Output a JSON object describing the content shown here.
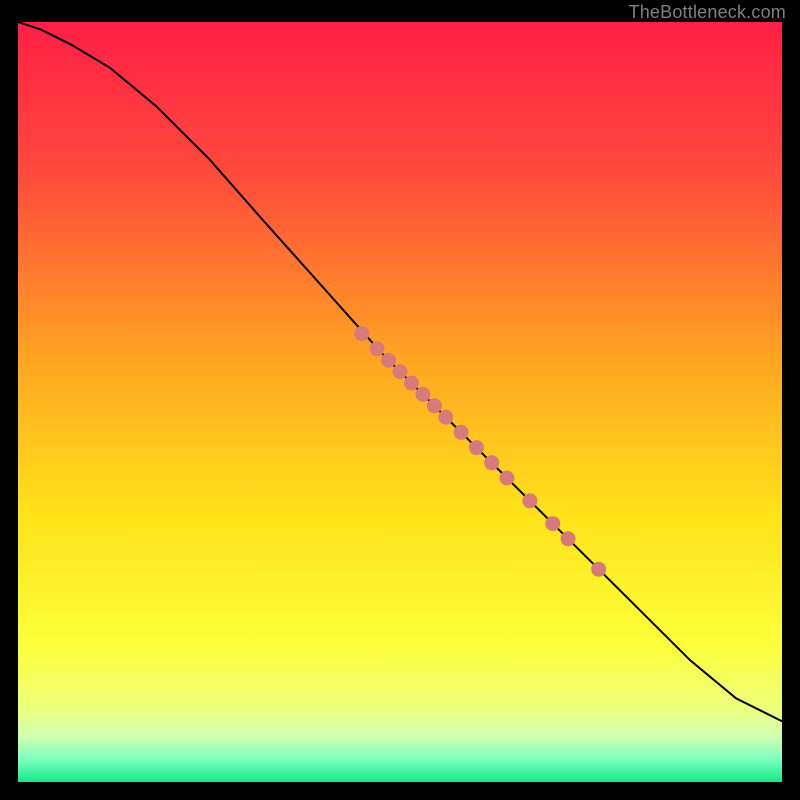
{
  "attribution": "TheBottleneck.com",
  "chart_data": {
    "type": "line",
    "title": "",
    "xlabel": "",
    "ylabel": "",
    "xlim": [
      0,
      100
    ],
    "ylim": [
      0,
      100
    ],
    "grid": false,
    "legend": false,
    "series": [
      {
        "name": "curve",
        "type": "line",
        "color": "#000000",
        "x": [
          0,
          3,
          7,
          12,
          18,
          25,
          32,
          40,
          48,
          56,
          64,
          72,
          80,
          88,
          94,
          100
        ],
        "y": [
          100,
          99,
          97,
          94,
          89,
          82,
          74,
          65,
          56,
          48,
          40,
          32,
          24,
          16,
          11,
          8
        ]
      },
      {
        "name": "markers",
        "type": "scatter",
        "color": "#d67a7a",
        "x": [
          45,
          47,
          48.5,
          50,
          51.5,
          53,
          54.5,
          56,
          58,
          60,
          62,
          64,
          67,
          70,
          72,
          76
        ],
        "y": [
          59,
          57,
          55.5,
          54,
          52.5,
          51,
          49.5,
          48,
          46,
          44,
          42,
          40,
          37,
          34,
          32,
          28
        ]
      }
    ],
    "background_gradient": {
      "stops": [
        {
          "offset": 0.0,
          "color": "#ff1f46"
        },
        {
          "offset": 0.2,
          "color": "#ff4a3c"
        },
        {
          "offset": 0.45,
          "color": "#ffa721"
        },
        {
          "offset": 0.65,
          "color": "#ffe31a"
        },
        {
          "offset": 0.82,
          "color": "#fcff3a"
        },
        {
          "offset": 0.9,
          "color": "#eeff7a"
        },
        {
          "offset": 0.94,
          "color": "#d0ffb0"
        },
        {
          "offset": 0.97,
          "color": "#7dffc0"
        },
        {
          "offset": 1.0,
          "color": "#18e889"
        }
      ]
    }
  }
}
